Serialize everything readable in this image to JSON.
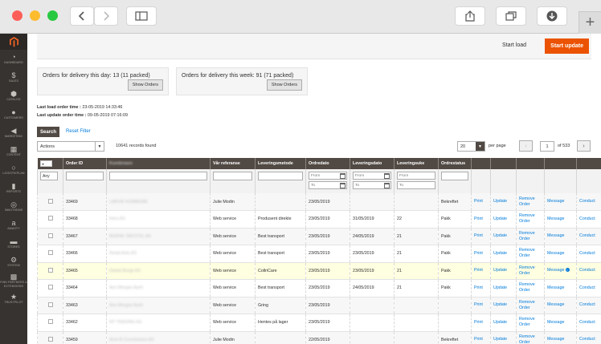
{
  "browser": {
    "icons": [
      "back-icon",
      "forward-icon",
      "sidebar-toggle-icon",
      "share-icon",
      "tabs-icon",
      "download-icon",
      "new-tab-icon"
    ]
  },
  "sidebar": {
    "items": [
      {
        "label": "DASHBOARD",
        "icon": "dashboard-icon",
        "glyph": "◔"
      },
      {
        "label": "SALES",
        "icon": "sales-icon",
        "glyph": "$"
      },
      {
        "label": "CATALOG",
        "icon": "catalog-icon",
        "glyph": "⬢"
      },
      {
        "label": "CUSTOMERS",
        "icon": "customers-icon",
        "glyph": "●"
      },
      {
        "label": "MARKETING",
        "icon": "marketing-icon",
        "glyph": "◀"
      },
      {
        "label": "CONTENT",
        "icon": "content-icon",
        "glyph": "▦"
      },
      {
        "label": "LOGISTIKPLAN",
        "icon": "logistikplan-icon",
        "glyph": "○"
      },
      {
        "label": "REPORTS",
        "icon": "reports-icon",
        "glyph": "▮"
      },
      {
        "label": "INNOTHEMS",
        "icon": "innothems-icon",
        "glyph": "◎"
      },
      {
        "label": "AMASTY",
        "icon": "amasty-icon",
        "glyph": "a"
      },
      {
        "label": "STORES",
        "icon": "stores-icon",
        "glyph": "▬"
      },
      {
        "label": "SYSTEM",
        "icon": "system-icon",
        "glyph": "⚙"
      },
      {
        "label": "FIND PARTNERS & EXTENSIONS",
        "icon": "partners-icon",
        "glyph": "▩"
      },
      {
        "label": "TRUSTPILOT",
        "icon": "trustpilot-icon",
        "glyph": "★"
      }
    ]
  },
  "header": {
    "start_load": "Start load",
    "start_update": "Start update"
  },
  "panels": {
    "day_title": "Orders for delivery this day: 13 (11 packed)",
    "week_title": "Orders for delivery this week: 91 (71 packed)",
    "show_orders": "Show Orders"
  },
  "info": {
    "last_load_label": "Last load order time :",
    "last_load_value": "23-05-2019 14:33:46",
    "last_update_label": "Last update order time :",
    "last_update_value": "09-05-2019 07:16:09"
  },
  "toolbar": {
    "search": "Search",
    "reset": "Reset Filter",
    "actions": "Actions",
    "records": "10641 records found",
    "per_page_value": "20",
    "per_page_label": "per page",
    "page": "1",
    "of_pages": "of 533"
  },
  "grid": {
    "headers": [
      "Order ID",
      "Kundenavn",
      "Vår referanse",
      "Leveringsmetode",
      "Ordredato",
      "Leveringsdato",
      "Leveringsuke",
      "Ordrestatus"
    ],
    "filter": {
      "any": "Any",
      "from": "From",
      "to": "To"
    },
    "actions": {
      "print": "Print",
      "update": "Update",
      "remove": "Remove Order",
      "message": "Message",
      "conduct": "Conduct"
    },
    "rows": [
      {
        "id": "33469",
        "name": "LARVIK KOMMUNE",
        "ref": "Julie Modin",
        "method": "",
        "odate": "23/05/2019",
        "ldate": "",
        "week": "",
        "status": "Bekreftet",
        "info": false
      },
      {
        "id": "33468",
        "name": "Heru AS",
        "ref": "Web service",
        "method": "Produsent direkte",
        "odate": "23/05/2019",
        "ldate": "31/05/2019",
        "week": "22",
        "status": "Pakk",
        "info": false
      },
      {
        "id": "33467",
        "name": "NORSK TAKSTOL AS",
        "ref": "Web service",
        "method": "Best transport",
        "odate": "23/05/2019",
        "ldate": "24/05/2019",
        "week": "21",
        "status": "Pakk",
        "info": false
      },
      {
        "id": "33466",
        "name": "Retail Antu AS",
        "ref": "Web service",
        "method": "Best transport",
        "odate": "23/05/2019",
        "ldate": "23/05/2019",
        "week": "21",
        "status": "Pakk",
        "info": false
      },
      {
        "id": "33465",
        "name": "Daniel Borge AS",
        "ref": "Web service",
        "method": "CollriCare",
        "odate": "23/05/2019",
        "ldate": "23/05/2019",
        "week": "21",
        "status": "Pakk",
        "info": true
      },
      {
        "id": "33464",
        "name": "Ann Morgan Ayeh",
        "ref": "Web service",
        "method": "Best transport",
        "odate": "23/05/2019",
        "ldate": "24/05/2019",
        "week": "21",
        "status": "Pakk",
        "info": false
      },
      {
        "id": "33463",
        "name": "Ann Morgan Ayeh",
        "ref": "Web service",
        "method": "Gring",
        "odate": "23/05/2019",
        "ldate": "",
        "week": "",
        "status": "",
        "info": false
      },
      {
        "id": "33462",
        "name": "KP TRADING AS",
        "ref": "Web service",
        "method": "Hentes på lager",
        "odate": "23/05/2019",
        "ldate": "",
        "week": "",
        "status": "",
        "info": false
      },
      {
        "id": "33459",
        "name": "Arne B Cornelussen AS",
        "ref": "Julie Modin",
        "method": "",
        "odate": "22/05/2019",
        "ldate": "",
        "week": "",
        "status": "Bekreftet",
        "info": false
      }
    ]
  }
}
